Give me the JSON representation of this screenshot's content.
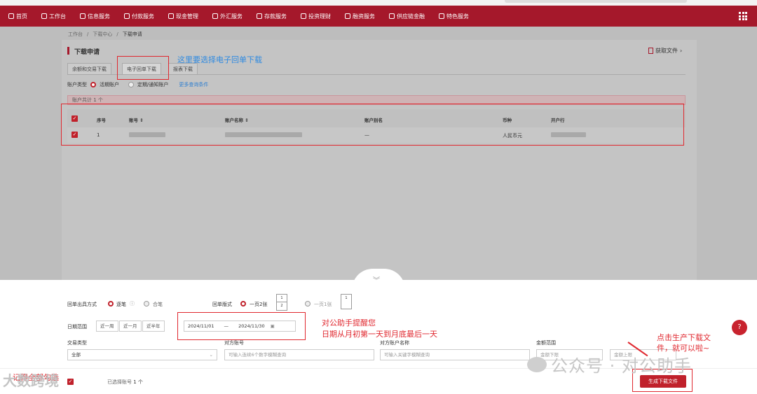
{
  "nav": {
    "items": [
      "首页",
      "工作台",
      "信息服务",
      "付款服务",
      "现金管理",
      "外汇服务",
      "存款服务",
      "投资理财",
      "融资服务",
      "供应链金融",
      "特色服务"
    ]
  },
  "breadcrumb": [
    "工作台",
    "/",
    "下载中心",
    "/",
    "下载申请"
  ],
  "page": {
    "title": "下载申请",
    "fetch_file": "获取文件"
  },
  "tabs": [
    "余额和交易下载",
    "电子回单下载",
    "报表下载"
  ],
  "account_type": {
    "label": "账户类型",
    "options": [
      "活期账户",
      "定期/通知账户"
    ],
    "selected": "活期账户",
    "more_link": "更多查询条件"
  },
  "count_text": "账户共计 1 个",
  "table": {
    "headers": [
      "序号",
      "账号 ⇕",
      "账户名称 ⇕",
      "账户别名",
      "币种",
      "开户行"
    ],
    "rows": [
      {
        "index": "1",
        "alias": "—",
        "currency": "人民币元"
      }
    ]
  },
  "form": {
    "receipt_method": {
      "label": "回单出具方式",
      "options": [
        "逐笔",
        "合笔"
      ],
      "selected": "逐笔"
    },
    "receipt_layout": {
      "label": "回单版式",
      "options": [
        "一页2张",
        "一页1张"
      ],
      "selected": "一页2张",
      "thumb_a": [
        "1",
        "2"
      ],
      "thumb_b": "1"
    },
    "date_range": {
      "label": "日期范围",
      "quick": [
        "近一周",
        "近一月",
        "近半年"
      ],
      "start": "2024/11/01",
      "sep": "—",
      "end": "2024/11/30"
    },
    "trade_type": {
      "label": "交易类型",
      "value": "全部"
    },
    "counter_account": {
      "label": "对方账号",
      "placeholder": "可输入连续6个数字模糊查询"
    },
    "counter_name": {
      "label": "对方账户名称",
      "placeholder": "可输入关键字模糊查询"
    },
    "amount_range": {
      "label": "金额范围",
      "placeholder_min": "金额下限",
      "placeholder_max": "金额上限"
    }
  },
  "footer": {
    "selected_label": "已选择账号",
    "selected_count": "1 个",
    "generate_button": "生成下载文件"
  },
  "annotations": {
    "tab_note": "这里要选择电子回单下载",
    "date_note_1": "对公助手提醒您",
    "date_note_2": "日期从月初第一天到月底最后一天",
    "gen_note_1": "点击生产下载文",
    "gen_note_2": "件，就可以啦~",
    "select_all_note": "记得全部勾选"
  },
  "watermark": {
    "text": "公众号 · 对公助手",
    "corner": "大数跨境"
  },
  "colors": {
    "brand": "#a5182b",
    "accent_red": "#c0212b",
    "annotation_red": "#e0282f",
    "annotation_blue": "#2f8ae0"
  }
}
